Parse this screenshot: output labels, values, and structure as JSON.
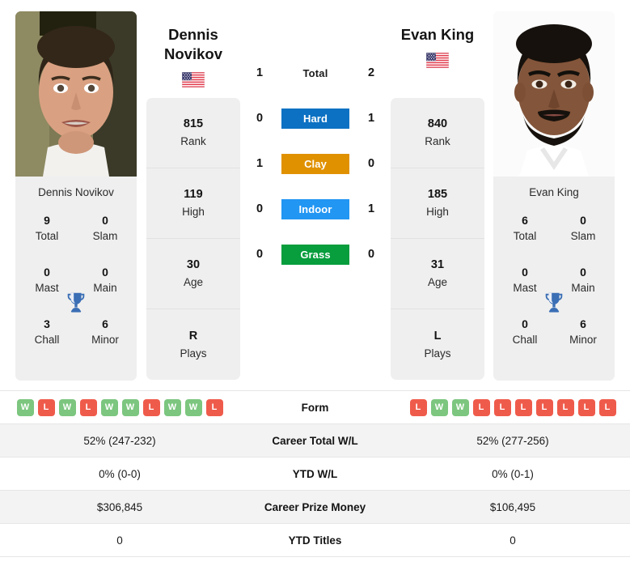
{
  "players": {
    "left": {
      "name": "Dennis Novikov",
      "name_line1": "Dennis",
      "name_line2": "Novikov",
      "flag": "us-flag-icon",
      "photo": "player-photo",
      "info": [
        {
          "value": "815",
          "label": "Rank"
        },
        {
          "value": "119",
          "label": "High"
        },
        {
          "value": "30",
          "label": "Age"
        },
        {
          "value": "R",
          "label": "Plays"
        }
      ],
      "titles": [
        {
          "value": "9",
          "label": "Total"
        },
        {
          "value": "0",
          "label": "Slam"
        },
        {
          "value": "0",
          "label": "Mast"
        },
        {
          "value": "0",
          "label": "Main"
        },
        {
          "value": "3",
          "label": "Chall"
        },
        {
          "value": "6",
          "label": "Minor"
        }
      ],
      "form": [
        "W",
        "L",
        "W",
        "L",
        "W",
        "W",
        "L",
        "W",
        "W",
        "L"
      ]
    },
    "right": {
      "name": "Evan King",
      "name_line1": "Evan King",
      "name_line2": "",
      "flag": "us-flag-icon",
      "photo": "player-photo",
      "info": [
        {
          "value": "840",
          "label": "Rank"
        },
        {
          "value": "185",
          "label": "High"
        },
        {
          "value": "31",
          "label": "Age"
        },
        {
          "value": "L",
          "label": "Plays"
        }
      ],
      "titles": [
        {
          "value": "6",
          "label": "Total"
        },
        {
          "value": "0",
          "label": "Slam"
        },
        {
          "value": "0",
          "label": "Mast"
        },
        {
          "value": "0",
          "label": "Main"
        },
        {
          "value": "0",
          "label": "Chall"
        },
        {
          "value": "6",
          "label": "Minor"
        }
      ],
      "form": [
        "L",
        "W",
        "W",
        "L",
        "L",
        "L",
        "L",
        "L",
        "L",
        "L"
      ]
    }
  },
  "trophy_icon": "trophy-icon",
  "h2h": [
    {
      "label": "Total",
      "left": "1",
      "right": "2",
      "badge": false,
      "color": ""
    },
    {
      "label": "Hard",
      "left": "0",
      "right": "1",
      "badge": true,
      "color": "#0c71c3"
    },
    {
      "label": "Clay",
      "left": "1",
      "right": "0",
      "badge": true,
      "color": "#e09100"
    },
    {
      "label": "Indoor",
      "left": "0",
      "right": "1",
      "badge": true,
      "color": "#2196f3"
    },
    {
      "label": "Grass",
      "left": "0",
      "right": "0",
      "badge": true,
      "color": "#089d3d"
    }
  ],
  "stats_rows": [
    {
      "label": "Form",
      "left": "",
      "right": "",
      "form": true,
      "shaded": false
    },
    {
      "label": "Career Total W/L",
      "left": "52% (247-232)",
      "right": "52% (277-256)",
      "form": false,
      "shaded": true
    },
    {
      "label": "YTD W/L",
      "left": "0% (0-0)",
      "right": "0% (0-1)",
      "form": false,
      "shaded": false
    },
    {
      "label": "Career Prize Money",
      "left": "$306,845",
      "right": "$106,495",
      "form": false,
      "shaded": true
    },
    {
      "label": "YTD Titles",
      "left": "0",
      "right": "0",
      "form": false,
      "shaded": false
    }
  ],
  "colors": {
    "win_badge": "#7cc67f",
    "loss_badge": "#ef5b4b",
    "card_bg": "#efefef",
    "row_shaded": "#f3f3f3",
    "trophy": "#3a6eb5"
  }
}
